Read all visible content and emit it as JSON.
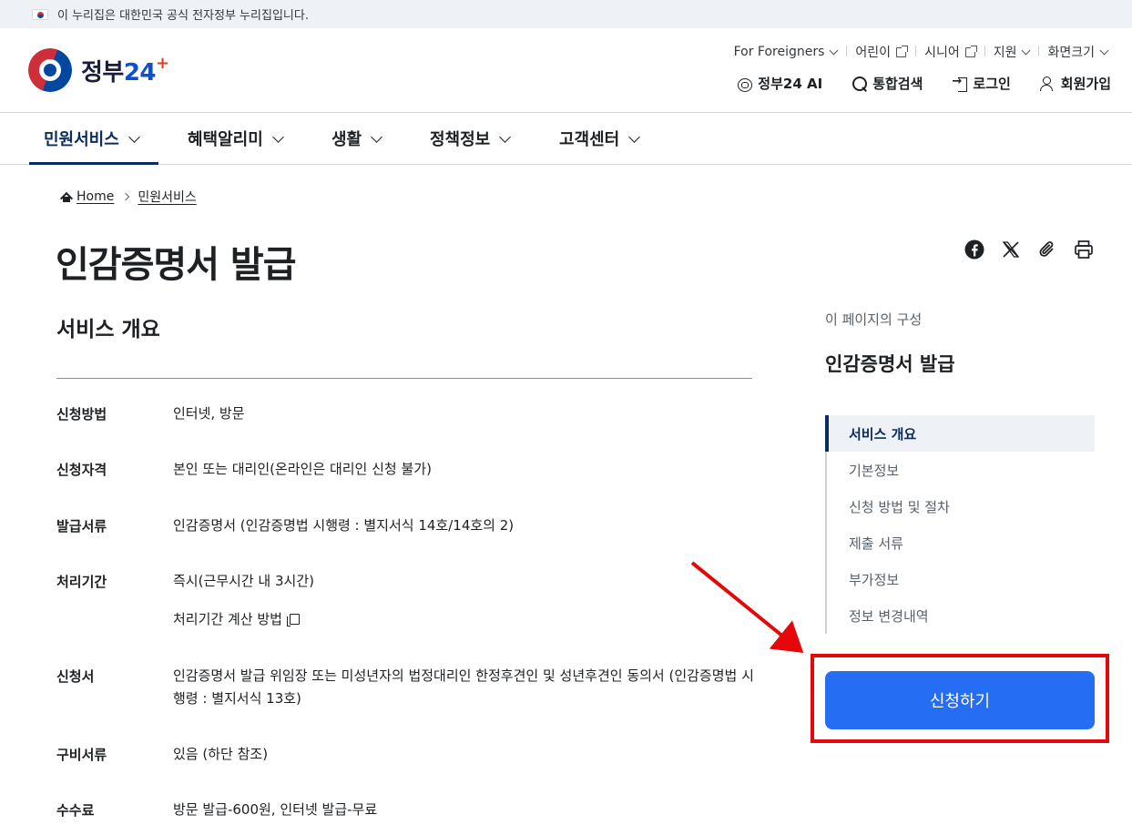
{
  "gov_banner": {
    "text": "이 누리집은 대한민국 공식 전자정부 누리집입니다."
  },
  "logo": {
    "text_main": "정부",
    "text_num": "24"
  },
  "util_nav": [
    {
      "label": "For Foreigners",
      "icon": "chevron-down-icon"
    },
    {
      "label": "어린이",
      "icon": "external-link-icon"
    },
    {
      "label": "시니어",
      "icon": "external-link-icon"
    },
    {
      "label": "지원",
      "icon": "chevron-down-icon"
    },
    {
      "label": "화면크기",
      "icon": "chevron-down-icon"
    }
  ],
  "main_util": {
    "ai": "정부24 AI",
    "search": "통합검색",
    "login": "로그인",
    "signup": "회원가입"
  },
  "gnb": [
    "민원서비스",
    "혜택알리미",
    "생활",
    "정책정보",
    "고객센터"
  ],
  "breadcrumb": {
    "home": "Home",
    "current": "민원서비스"
  },
  "page_title": "인감증명서 발급",
  "section": {
    "title": "서비스 개요",
    "rows": [
      {
        "label": "신청방법",
        "value": "인터넷, 방문"
      },
      {
        "label": "신청자격",
        "value": "본인 또는 대리인(온라인은 대리인 신청 불가)"
      },
      {
        "label": "발급서류",
        "value": "인감증명서 (인감증명법 시행령 : 별지서식 14호/14호의 2)"
      },
      {
        "label": "처리기간",
        "value": "즉시(근무시간 내 3시간)",
        "extra": "처리기간 계산 방법"
      },
      {
        "label": "신청서",
        "value": "인감증명서 발급 위임장 또는 미성년자의 법정대리인 한정후견인 및 성년후견인 동의서 (인감증명법 시행령 : 별지서식 13호)"
      },
      {
        "label": "구비서류",
        "value": "있음 (하단 참조)"
      },
      {
        "label": "수수료",
        "value": "방문 발급-600원, 인터넷 발급-무료"
      }
    ]
  },
  "toc": {
    "caption": "이 페이지의 구성",
    "title": "인감증명서 발급",
    "items": [
      "서비스 개요",
      "기본정보",
      "신청 방법 및 절차",
      "제출 서류",
      "부가정보",
      "정보 변경내역"
    ]
  },
  "apply_button": "신청하기",
  "colors": {
    "primary": "#256ef4",
    "navy": "#0b2c5f",
    "annotation_red": "#e4080a"
  }
}
